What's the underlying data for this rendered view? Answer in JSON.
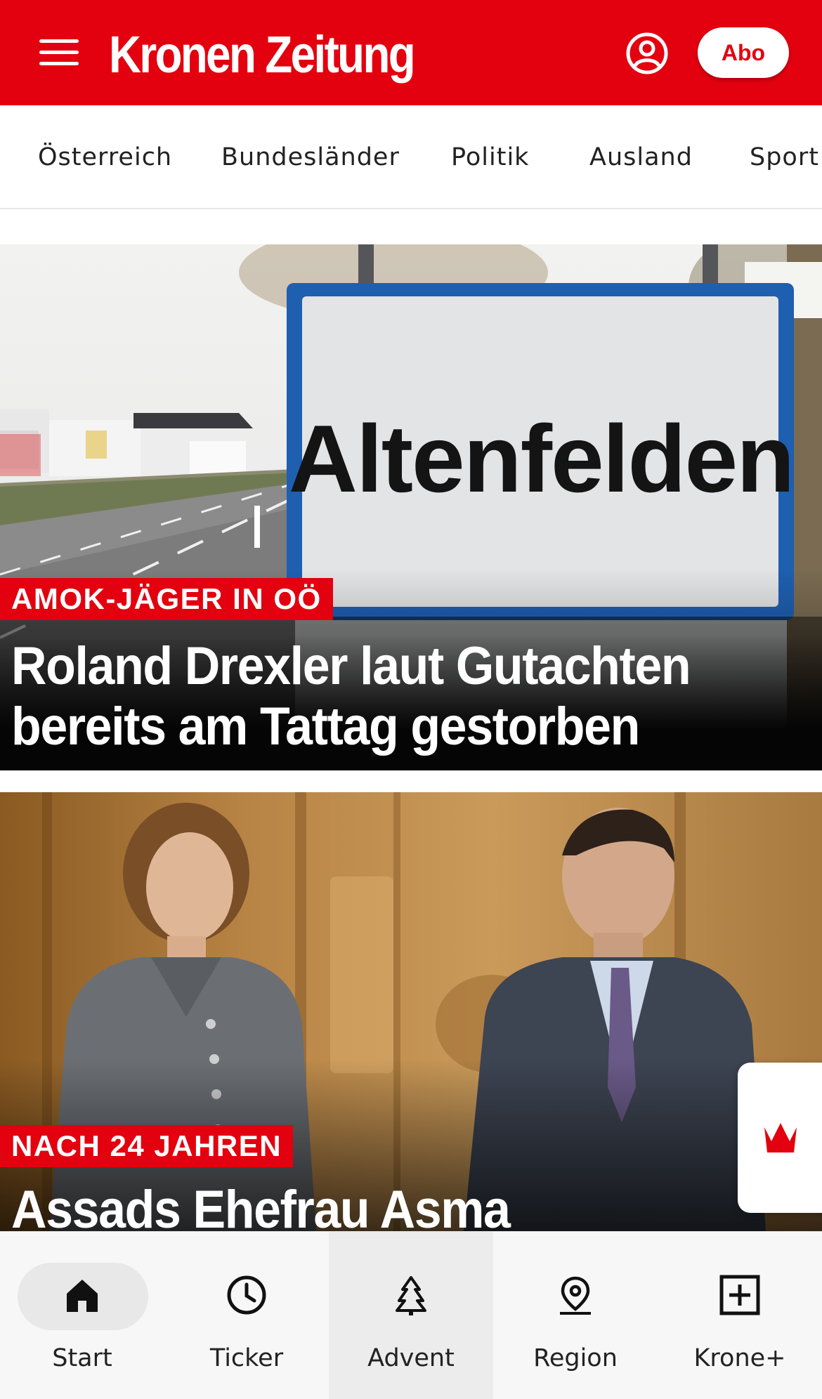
{
  "header": {
    "logo": "Kronen Zeitung",
    "abo_label": "Abo",
    "brand_color": "#e3000f",
    "menu_icon": "hamburger-icon",
    "account_icon": "account-icon"
  },
  "categories": [
    "Österreich",
    "Bundesländer",
    "Politik",
    "Ausland",
    "Sport"
  ],
  "articles": [
    {
      "kicker": "AMOK-JÄGER IN OÖ",
      "headline_line1": "Roland Drexler laut Gutachten",
      "headline_line2": "bereits am Tattag gestorben",
      "sign_text": "Altenfelden"
    },
    {
      "kicker": "NACH 24 JAHREN",
      "headline_line1": "Assads Ehefrau Asma"
    }
  ],
  "floating_button": {
    "icon": "krone-crown-icon"
  },
  "bottom_nav": {
    "items": [
      {
        "label": "Start",
        "icon": "home-icon"
      },
      {
        "label": "Ticker",
        "icon": "clock-icon"
      },
      {
        "label": "Advent",
        "icon": "tree-icon"
      },
      {
        "label": "Region",
        "icon": "location-pin-icon"
      },
      {
        "label": "Krone+",
        "icon": "plus-box-icon"
      }
    ]
  }
}
